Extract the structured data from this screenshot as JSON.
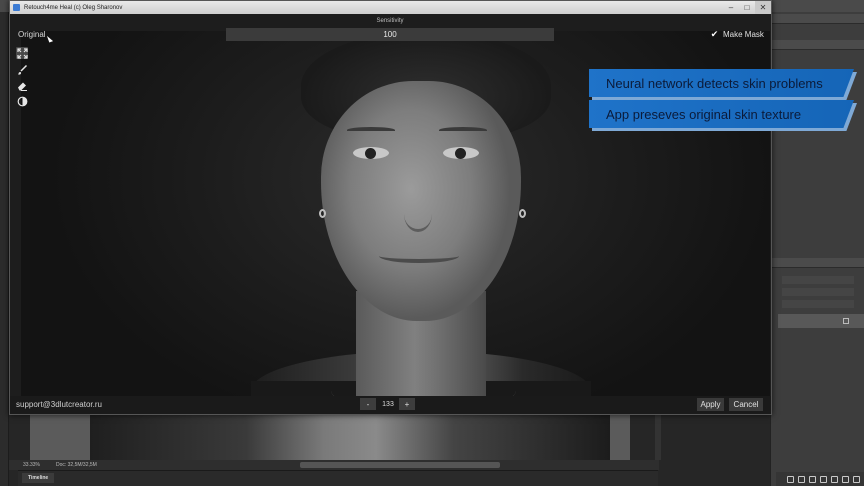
{
  "window": {
    "title": "Retouch4me Heal (c) Oleg Sharonov"
  },
  "toolbar": {
    "original_label": "Original",
    "sensitivity_label": "Sensitivity",
    "sensitivity_value": "100",
    "make_mask_label": "Make Mask",
    "make_mask_checked": true
  },
  "tools": [
    {
      "name": "fit-icon"
    },
    {
      "name": "brush-icon"
    },
    {
      "name": "eraser-icon"
    },
    {
      "name": "contrast-icon"
    }
  ],
  "footer": {
    "support_email": "support@3dlutcreator.ru",
    "zoom_minus": "-",
    "zoom_value": "133",
    "zoom_plus": "+",
    "apply_label": "Apply",
    "cancel_label": "Cancel"
  },
  "overlay": {
    "line1": "Neural network detects skin problems",
    "line2": "App preseves original skin texture"
  },
  "photoshop": {
    "zoom_status": "33.33%",
    "doc_status": "Doc: 32,5M/32,5M",
    "timeline_tab": "Timeline"
  },
  "colors": {
    "banner_blue": "#1f73c9",
    "banner_text": "#0b1b3a",
    "window_bg": "#1d1d1d"
  }
}
